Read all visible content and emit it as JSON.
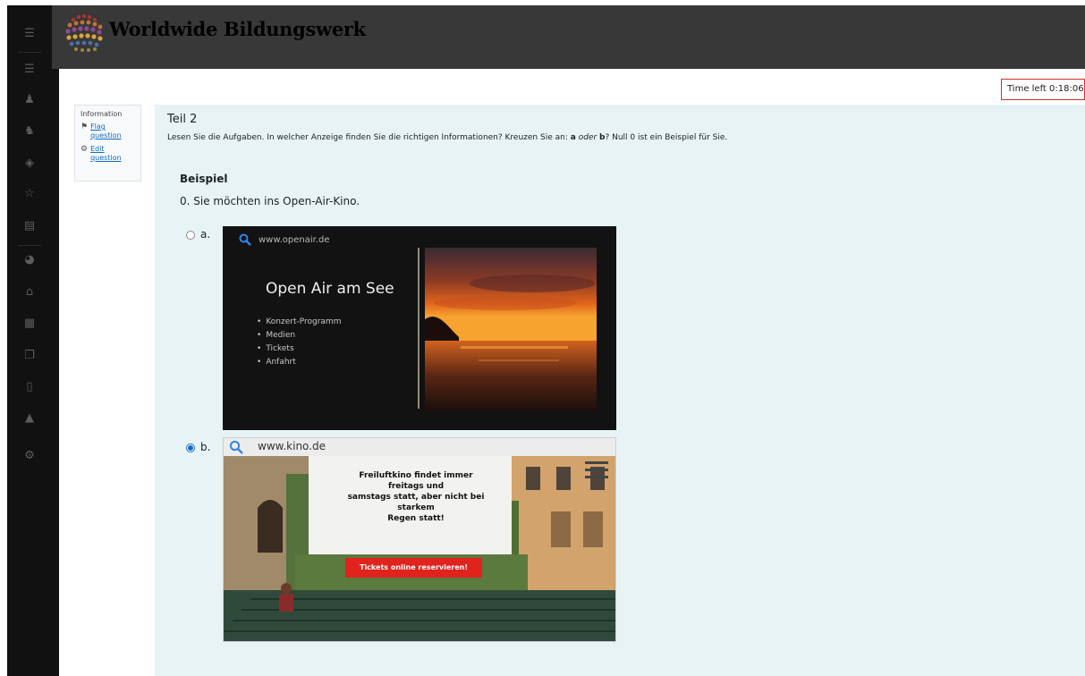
{
  "header": {
    "site_title": "Worldwide Bildungswerk"
  },
  "timer": {
    "text": "Time left 0:18:06"
  },
  "sidebar": {
    "icons": [
      "menu-icon",
      "list-icon",
      "user-icon",
      "user-group-icon",
      "layers-icon",
      "star-icon",
      "book-icon",
      "dashboard-icon",
      "home-icon",
      "calendar-icon",
      "copy-icon",
      "clipboard-icon",
      "graduation-cap-icon",
      "gear-icon"
    ]
  },
  "info": {
    "title": "Information",
    "flag_label": "Flag question",
    "edit_label": "Edit question"
  },
  "question": {
    "teil": "Teil 2",
    "instruction_pre": "Lesen Sie die Aufgaben. In welcher Anzeige finden Sie die richtigen Informationen? Kreuzen Sie an: ",
    "instruction_a": "a",
    "instruction_oder": "oder",
    "instruction_b": "b",
    "instruction_post": "? Null 0 ist ein Beispiel für Sie.",
    "beispiel": "Beispiel",
    "prompt": "0. Sie möchten ins Open-Air-Kino.",
    "options": [
      {
        "letter": "a.",
        "checked": false,
        "url": "www.openair.de",
        "headline": "Open Air am See",
        "items": [
          "Konzert-Programm",
          "Medien",
          "Tickets",
          "Anfahrt"
        ]
      },
      {
        "letter": "b.",
        "checked": true,
        "url": "www.kino.de",
        "screen_lines": [
          "Freiluftkino findet immer",
          "freitags und",
          "samstags statt, aber nicht bei",
          "starkem",
          "Regen statt!"
        ],
        "button": "Tickets online reservieren!"
      }
    ]
  },
  "colors": {
    "accent": "#0f6cbf",
    "header_bg": "#383838",
    "sidebar_bg": "#111111",
    "question_bg": "#e7f3f5",
    "timer_border": "#c9302c",
    "ticket_red": "#e0231c"
  }
}
